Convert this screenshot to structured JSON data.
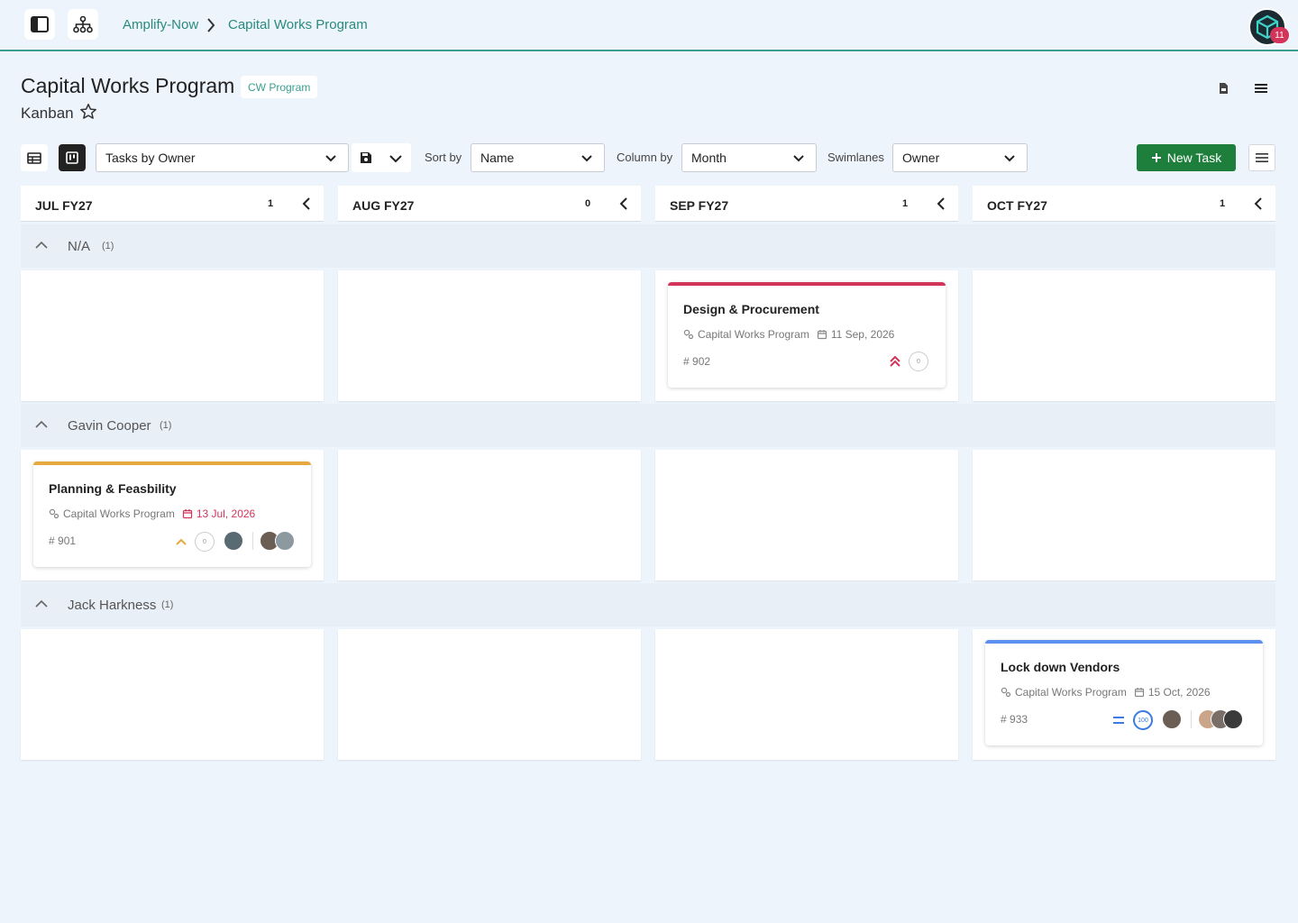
{
  "topbar": {
    "breadcrumb": [
      "Amplify-Now",
      "Capital Works Program"
    ],
    "notification_count": "11",
    "icons": [
      "sidebar-toggle-icon",
      "hierarchy-icon",
      "cube-logo-icon"
    ]
  },
  "header": {
    "title": "Capital Works Program",
    "badge": "CW Program",
    "view_name": "Kanban",
    "icons": [
      "star-icon",
      "pdf-file-icon",
      "hamburger-menu-icon"
    ]
  },
  "toolbar": {
    "view_select": "Tasks by Owner",
    "sort_label": "Sort by",
    "sort_value": "Name",
    "column_label": "Column by",
    "column_value": "Month",
    "swimlane_label": "Swimlanes",
    "swimlane_value": "Owner",
    "new_task_label": "New Task",
    "icons": [
      "table-view-icon",
      "kanban-view-icon",
      "save-icon",
      "chevron-down-icon",
      "plus-icon",
      "list-menu-icon"
    ]
  },
  "columns": [
    {
      "title": "JUL FY27",
      "count": "1"
    },
    {
      "title": "AUG FY27",
      "count": "0"
    },
    {
      "title": "SEP FY27",
      "count": "1"
    },
    {
      "title": "OCT FY27",
      "count": "1"
    }
  ],
  "lanes": [
    {
      "name": "N/A",
      "count": "(1)"
    },
    {
      "name": "Gavin Cooper",
      "count": "(1)"
    },
    {
      "name": "Jack Harkness",
      "count": "(1)"
    }
  ],
  "cards": [
    {
      "title": "Design & Procurement",
      "project": "Capital Works Program",
      "date": "11 Sep, 2026",
      "id": "902",
      "progress": "0",
      "priority": "highest",
      "bar_color": "#d2345a",
      "date_color": "#777777"
    },
    {
      "title": "Planning & Feasbility",
      "project": "Capital Works Program",
      "date": "13 Jul, 2026",
      "id": "901",
      "progress": "0",
      "priority": "high",
      "bar_color": "#e6a93f",
      "date_color": "#d2345a"
    },
    {
      "title": "Lock down Vendors",
      "project": "Capital Works Program",
      "date": "15 Oct, 2026",
      "id": "933",
      "progress": "100",
      "priority": "medium",
      "bar_color": "#5b8ff0",
      "date_color": "#777777"
    }
  ]
}
